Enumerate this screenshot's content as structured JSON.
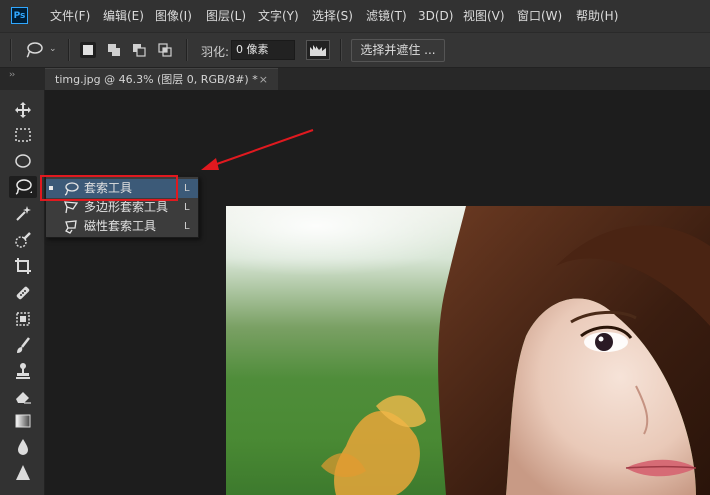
{
  "app": {
    "logo_text": "Ps"
  },
  "menu": {
    "items": [
      "文件(F)",
      "编辑(E)",
      "图像(I)",
      "图层(L)",
      "文字(Y)",
      "选择(S)",
      "滤镜(T)",
      "3D(D)",
      "视图(V)",
      "窗口(W)",
      "帮助(H)"
    ]
  },
  "options": {
    "caret": "⌄",
    "feather_label": "羽化:",
    "feather_value": "0 像素",
    "select_mask_label": "选择并遮住 ..."
  },
  "document": {
    "panel_collapse": "››",
    "tab_title": "timg.jpg @ 46.3% (图层 0, RGB/8#) *",
    "tab_close": "×"
  },
  "flyout": {
    "items": [
      {
        "label": "套索工具",
        "shortcut": "L",
        "icon": "lasso-icon",
        "selected": true
      },
      {
        "label": "多边形套索工具",
        "shortcut": "L",
        "icon": "polygonal-lasso-icon",
        "selected": false
      },
      {
        "label": "磁性套索工具",
        "shortcut": "L",
        "icon": "magnetic-lasso-icon",
        "selected": false
      }
    ]
  },
  "tools": [
    "move-icon",
    "marquee-icon",
    "ellipse-marquee-icon",
    "lasso-icon",
    "magic-wand-icon",
    "quick-selection-icon",
    "crop-icon",
    "healing-brush-icon",
    "patch-icon",
    "brush-icon",
    "clone-stamp-icon",
    "eraser-icon",
    "gradient-icon",
    "blur-icon",
    "sharpen-icon"
  ],
  "colors": {
    "annotation": "#e0191f",
    "selection": "#3c5a78",
    "accent": "#31a8ff"
  }
}
